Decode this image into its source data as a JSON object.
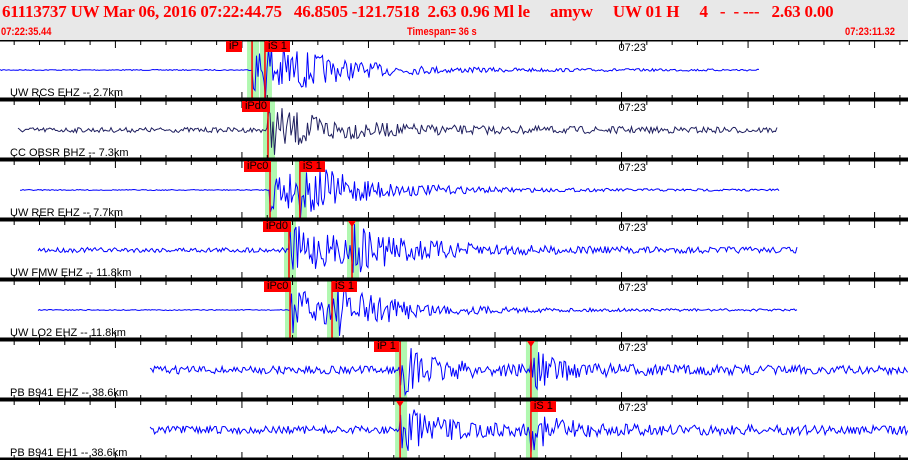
{
  "header": {
    "title": "61113737 UW Mar 06, 2016 07:22:44.75   46.8505 -121.7518  2.63 0.96 Ml le     amyw     UW 01 H     4   -  - ---   2.63 0.00",
    "start_time": "07:22:35.44",
    "timespan": "Timespan=  36 s",
    "end_time": "07:23:11.32"
  },
  "colors": {
    "header_text": "#ff0000",
    "trace": "#0000ff",
    "trace_dark": "#202060",
    "pick": "#ff0000",
    "window": "#b0f8b0"
  },
  "minute_label": "07:23",
  "traces": [
    {
      "label": "UW RCS EHZ -- 2.7km",
      "color": "#0000ff",
      "start": "07:22:35.44",
      "end": "07:23:05.47",
      "picks": [
        {
          "label": "iP",
          "time": "07:22:45.40"
        },
        {
          "label": "iS 1",
          "time": "07:22:45.91"
        }
      ]
    },
    {
      "label": "CC OBSR BHZ -- 7.3km",
      "color": "#202060",
      "start": "07:22:36.15",
      "end": "07:23:06.18",
      "picks": [
        {
          "label": "iPd0",
          "time": "07:22:46.03"
        }
      ]
    },
    {
      "label": "UW RER EHZ -- 7.7km",
      "color": "#0000ff",
      "start": "07:22:36.23",
      "end": "07:23:06.26",
      "picks": [
        {
          "label": "iPc0",
          "time": "07:22:46.11"
        },
        {
          "label": "iS 1",
          "time": "07:22:47.29"
        }
      ]
    },
    {
      "label": "UW FMW EHZ -- 11.8km",
      "color": "#0000ff",
      "start": "07:22:36.94",
      "end": "07:23:06.97",
      "picks": [
        {
          "label": "iPd0",
          "time": "07:22:46.86"
        },
        {
          "label": "",
          "time": "07:22:49.35"
        }
      ]
    },
    {
      "label": "UW LO2 EHZ -- 11.8km",
      "color": "#0000ff",
      "start": "07:22:36.94",
      "end": "07:23:06.97",
      "picks": [
        {
          "label": "iPc0",
          "time": "07:22:46.90"
        },
        {
          "label": "iS 1",
          "time": "07:22:48.56"
        }
      ]
    },
    {
      "label": "PB B941 EHZ -- 38.6km",
      "color": "#0000ff",
      "start": "07:22:41.37",
      "end": "07:23:11.32",
      "picks": [
        {
          "label": "iP 1",
          "time": "07:22:51.25"
        },
        {
          "label": "",
          "time": "07:22:56.42"
        }
      ]
    },
    {
      "label": "PB B941 EH1 -- 38.6km",
      "color": "#0000ff",
      "start": "07:22:41.37",
      "end": "07:23:11.32",
      "picks": [
        {
          "label": "",
          "time": "07:22:51.25"
        },
        {
          "label": "iS 1",
          "time": "07:22:56.42"
        }
      ]
    }
  ]
}
